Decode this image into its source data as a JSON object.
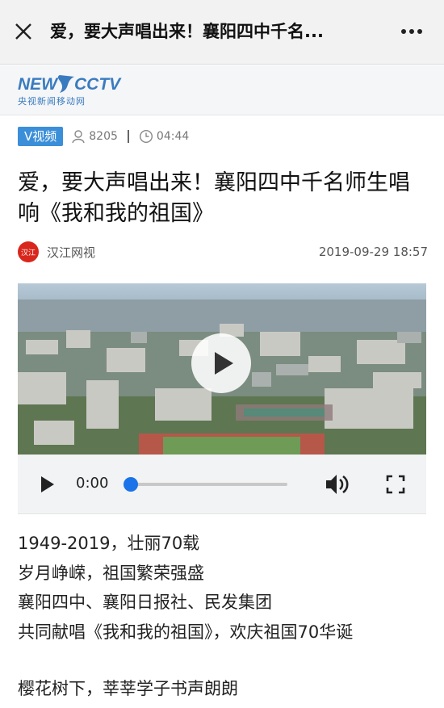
{
  "topbar": {
    "title": "爱，要大声唱出来！襄阳四中千名...",
    "close_icon": "close-icon",
    "more_icon": "more-dots-icon"
  },
  "brand": {
    "logo_text": "NEWS CCTV",
    "subtitle": "央视新闻移动网",
    "color": "#3a7bbf"
  },
  "meta": {
    "tag": "V视频",
    "views": "8205",
    "duration": "04:44"
  },
  "article": {
    "headline": "爱，要大声唱出来！襄阳四中千名师生唱响《我和我的祖国》",
    "source_name": "汉江网视",
    "source_logo": "汉江",
    "published": "2019-09-29 18:57"
  },
  "player": {
    "current_time": "0:00",
    "progress": 0,
    "accent": "#1a73e8"
  },
  "body": {
    "lines": [
      "1949-2019，壮丽70载",
      "岁月峥嵘，祖国繁荣强盛",
      "襄阳四中、襄阳日报社、民发集团",
      "共同献唱《我和我的祖国》，欢庆祖国70华诞",
      "樱花树下，莘莘学子书声朗朗"
    ]
  }
}
